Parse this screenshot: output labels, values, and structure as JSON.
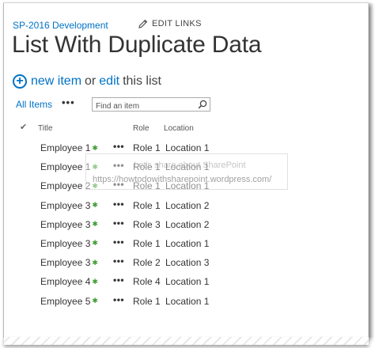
{
  "header": {
    "site_link": "SP-2016 Development",
    "edit_links": "EDIT LINKS"
  },
  "page_title": "List With Duplicate Data",
  "actions": {
    "new_item": "new item",
    "or": "or",
    "edit": "edit",
    "this_list": "this list"
  },
  "views": {
    "all_items": "All Items",
    "more": "•••",
    "search_placeholder": "Find an item"
  },
  "columns": {
    "title": "Title",
    "role": "Role",
    "location": "Location"
  },
  "rows": [
    {
      "title": "Employee 1",
      "role": "Role 1",
      "location": "Location 1"
    },
    {
      "title": "Employee 1",
      "role": "Role 1",
      "location": "Location 1"
    },
    {
      "title": "Employee 2",
      "role": "Role 1",
      "location": "Location 1"
    },
    {
      "title": "Employee 3",
      "role": "Role 1",
      "location": "Location 2"
    },
    {
      "title": "Employee 3",
      "role": "Role 3",
      "location": "Location 2"
    },
    {
      "title": "Employee 3",
      "role": "Role 1",
      "location": "Location 1"
    },
    {
      "title": "Employee 3",
      "role": "Role 2",
      "location": "Location 3"
    },
    {
      "title": "Employee 4",
      "role": "Role 4",
      "location": "Location 1"
    },
    {
      "title": "Employee 5",
      "role": "Role 1",
      "location": "Location 1"
    }
  ],
  "row_more": "•••",
  "new_badge": "✱",
  "watermark": {
    "line1": "Let's share about SharePoint",
    "line2": "https://howtodowithsharepoint.wordpress.com/"
  },
  "colors": {
    "link_blue": "#0072c6",
    "new_badge_green": "#3f9c35"
  }
}
